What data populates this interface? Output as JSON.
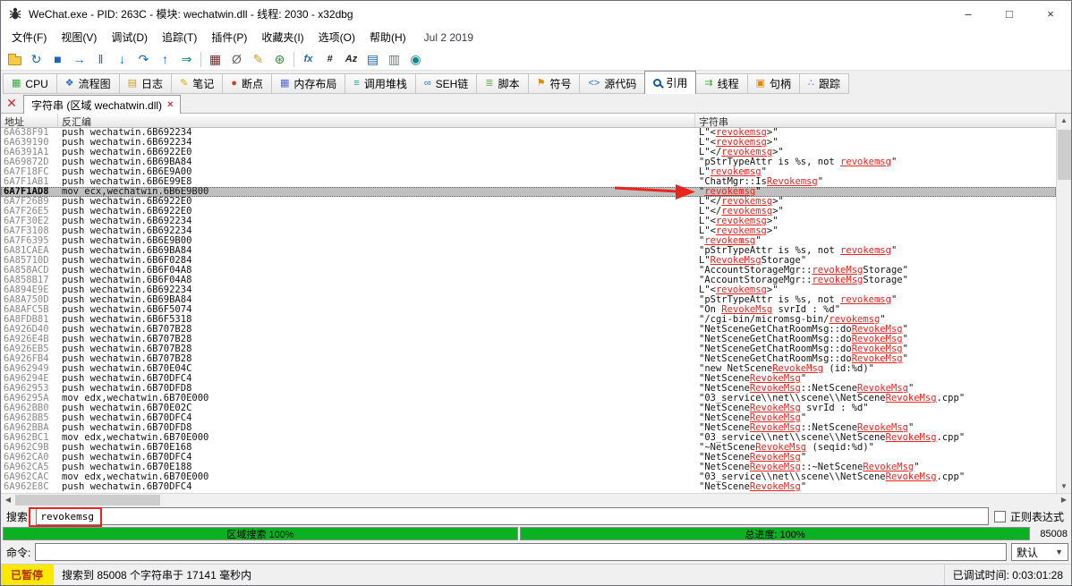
{
  "colors": {
    "progress_green": "#0ab123",
    "status_paused_bg": "#ffe800",
    "status_paused_fg": "#b32d00",
    "match_red": "#e8251f",
    "annotation_red": "#e8251f",
    "selection_gray": "#c0c0c0"
  },
  "title_bar": {
    "title": "WeChat.exe - PID: 263C - 模块: wechatwin.dll - 线程: 2030 - x32dbg",
    "minimize": "–",
    "maximize": "□",
    "close": "×"
  },
  "menu": {
    "items": [
      "文件(F)",
      "视图(V)",
      "调试(D)",
      "追踪(T)",
      "插件(P)",
      "收藏夹(I)",
      "选项(O)",
      "帮助(H)"
    ],
    "build_date": "Jul 2 2019"
  },
  "toolbar": {
    "items": [
      {
        "name": "open-file-icon",
        "type": "folder"
      },
      {
        "name": "restart-icon",
        "glyph": "↻",
        "color": "#1667c0"
      },
      {
        "name": "stop-icon",
        "glyph": "■",
        "color": "#1667c0"
      },
      {
        "name": "run-icon",
        "glyph": "→",
        "color": "#1667c0"
      },
      {
        "name": "pause-icon",
        "glyph": "‖",
        "color": "#1667c0"
      },
      {
        "name": "step-into-icon",
        "glyph": "↓",
        "color": "#1667c0"
      },
      {
        "name": "step-over-icon",
        "glyph": "↷",
        "color": "#1667c0"
      },
      {
        "name": "execute-till-return-icon",
        "glyph": "↑",
        "color": "#1667c0"
      },
      {
        "name": "run-to-user-code-icon",
        "glyph": "⇒",
        "color": "#0b8793"
      },
      {
        "name": "separator"
      },
      {
        "name": "patches-icon",
        "glyph": "▦",
        "color": "#8b1a1a"
      },
      {
        "name": "hide-debugger-icon",
        "glyph": "Ø",
        "color": "#666666"
      },
      {
        "name": "comment-icon",
        "glyph": "✎",
        "color": "#c9a227"
      },
      {
        "name": "settings-icon",
        "glyph": "⊛",
        "color": "#3a7d3a"
      },
      {
        "name": "separator"
      },
      {
        "name": "functions-icon",
        "glyph": "fx",
        "color": "#1667c0",
        "text": true
      },
      {
        "name": "calculator-icon",
        "glyph": "#",
        "color": "#222222",
        "text": true
      },
      {
        "name": "font-icon",
        "glyph": "Az",
        "color": "#222222",
        "text": true
      },
      {
        "name": "log-window-icon",
        "glyph": "▤",
        "color": "#1667c0"
      },
      {
        "name": "memory-window-icon",
        "glyph": "▥",
        "color": "#607d8b"
      },
      {
        "name": "animate-icon",
        "glyph": "◉",
        "color": "#0b8793"
      }
    ]
  },
  "tabs": [
    {
      "name": "tab-cpu",
      "label": "CPU",
      "icon": "cpu-icon",
      "glyph": "▦",
      "color": "#3da53d",
      "active": false
    },
    {
      "name": "tab-graph",
      "label": "流程图",
      "icon": "graph-icon",
      "glyph": "❖",
      "color": "#2b6fd4",
      "active": false
    },
    {
      "name": "tab-log",
      "label": "日志",
      "icon": "log-icon",
      "glyph": "▤",
      "color": "#c9a227",
      "active": false
    },
    {
      "name": "tab-notes",
      "label": "笔记",
      "icon": "notes-icon",
      "glyph": "✎",
      "color": "#d6a800",
      "active": false
    },
    {
      "name": "tab-breakpoints",
      "label": "断点",
      "icon": "breakpoint-icon",
      "glyph": "●",
      "color": "#d23f31",
      "active": false
    },
    {
      "name": "tab-memory-map",
      "label": "内存布局",
      "icon": "memory-map-icon",
      "glyph": "▦",
      "color": "#5566c9",
      "active": false
    },
    {
      "name": "tab-call-stack",
      "label": "调用堆栈",
      "icon": "call-stack-icon",
      "glyph": "≡",
      "color": "#2a9d8f",
      "active": false
    },
    {
      "name": "tab-seh",
      "label": "SEH链",
      "icon": "seh-chain-icon",
      "glyph": "∞",
      "color": "#2b6fd4",
      "active": false
    },
    {
      "name": "tab-script",
      "label": "脚本",
      "icon": "script-icon",
      "glyph": "≣",
      "color": "#6aa84f",
      "active": false
    },
    {
      "name": "tab-symbols",
      "label": "符号",
      "icon": "symbols-icon",
      "glyph": "⚑",
      "color": "#e08a00",
      "active": false
    },
    {
      "name": "tab-source",
      "label": "源代码",
      "icon": "source-icon",
      "glyph": "<>",
      "color": "#2b6fd4",
      "active": false
    },
    {
      "name": "tab-references",
      "label": "引用",
      "icon": "search-icon",
      "glyph": "",
      "color": "#13599e",
      "active": true
    },
    {
      "name": "tab-threads",
      "label": "线程",
      "icon": "threads-icon",
      "glyph": "⇉",
      "color": "#3da53d",
      "active": false
    },
    {
      "name": "tab-handles",
      "label": "句柄",
      "icon": "handles-icon",
      "glyph": "▣",
      "color": "#e08a00",
      "active": false
    },
    {
      "name": "tab-trace",
      "label": "跟踪",
      "icon": "trace-icon",
      "glyph": "∴",
      "color": "#7b4fd4",
      "active": false
    }
  ],
  "view_tab": {
    "label": "字符串 (区域 wechatwin.dll)",
    "close_glyph": "×"
  },
  "table": {
    "columns": [
      "地址",
      "反汇编",
      "字符串"
    ],
    "rows": [
      {
        "address": "6A638F91",
        "disasm": "push wechatwin.6B692234",
        "string": "L\"<revokemsg>\""
      },
      {
        "address": "6A639190",
        "disasm": "push wechatwin.6B692234",
        "string": "L\"<revokemsg>\""
      },
      {
        "address": "6A6391A1",
        "disasm": "push wechatwin.6B6922E0",
        "string": "L\"</revokemsg>\""
      },
      {
        "address": "6A69872D",
        "disasm": "push wechatwin.6B69BA84",
        "string": "\"pStrTypeAttr is %s, not revokemsg\""
      },
      {
        "address": "6A7F18FC",
        "disasm": "push wechatwin.6B6E9A00",
        "string": "L\"revokemsg\""
      },
      {
        "address": "6A7F1AB1",
        "disasm": "push wechatwin.6B6E99E8",
        "string": "\"ChatMgr::IsRevokemsg\""
      },
      {
        "address": "6A7F1AD8",
        "disasm": "mov ecx,wechatwin.6B6E9B00",
        "string": "\"revokemsg\"",
        "selected": true
      },
      {
        "address": "6A7F26B9",
        "disasm": "push wechatwin.6B6922E0",
        "string": "L\"</revokemsg>\""
      },
      {
        "address": "6A7F26E5",
        "disasm": "push wechatwin.6B6922E0",
        "string": "L\"</revokemsg>\""
      },
      {
        "address": "6A7F30E2",
        "disasm": "push wechatwin.6B692234",
        "string": "L\"<revokemsg>\""
      },
      {
        "address": "6A7F3108",
        "disasm": "push wechatwin.6B692234",
        "string": "L\"<revokemsg>\""
      },
      {
        "address": "6A7F6395",
        "disasm": "push wechatwin.6B6E9B00",
        "string": "\"revokemsg\""
      },
      {
        "address": "6A81CAEA",
        "disasm": "push wechatwin.6B69BA84",
        "string": "\"pStrTypeAttr is %s, not revokemsg\""
      },
      {
        "address": "6A85710D",
        "disasm": "push wechatwin.6B6F0284",
        "string": "L\"RevokeMsgStorage\""
      },
      {
        "address": "6A858ACD",
        "disasm": "push wechatwin.6B6F04A8",
        "string": "\"AccountStorageMgr::revokeMsgStorage\""
      },
      {
        "address": "6A858B17",
        "disasm": "push wechatwin.6B6F04A8",
        "string": "\"AccountStorageMgr::revokeMsgStorage\""
      },
      {
        "address": "6A894E9E",
        "disasm": "push wechatwin.6B692234",
        "string": "L\"<revokemsg>\""
      },
      {
        "address": "6A8A750D",
        "disasm": "push wechatwin.6B69BA84",
        "string": "\"pStrTypeAttr is %s, not revokemsg\""
      },
      {
        "address": "6A8AFC5B",
        "disasm": "push wechatwin.6B6F5074",
        "string": "\"On RevokeMsg svrId : %d\""
      },
      {
        "address": "6A8FDB81",
        "disasm": "push wechatwin.6B6F5318",
        "string": "\"/cgi-bin/micromsg-bin/revokemsg\""
      },
      {
        "address": "6A926D40",
        "disasm": "push wechatwin.6B707B28",
        "string": "\"NetSceneGetChatRoomMsg::doRevokeMsg\""
      },
      {
        "address": "6A926E4B",
        "disasm": "push wechatwin.6B707B28",
        "string": "\"NetSceneGetChatRoomMsg::doRevokeMsg\""
      },
      {
        "address": "6A926EB5",
        "disasm": "push wechatwin.6B707B28",
        "string": "\"NetSceneGetChatRoomMsg::doRevokeMsg\""
      },
      {
        "address": "6A926FB4",
        "disasm": "push wechatwin.6B707B28",
        "string": "\"NetSceneGetChatRoomMsg::doRevokeMsg\""
      },
      {
        "address": "6A962949",
        "disasm": "push wechatwin.6B70E04C",
        "string": "\"new NetSceneRevokeMsg (id:%d)\""
      },
      {
        "address": "6A96294E",
        "disasm": "push wechatwin.6B70DFC4",
        "string": "\"NetSceneRevokeMsg\""
      },
      {
        "address": "6A962953",
        "disasm": "push wechatwin.6B70DFD8",
        "string": "\"NetSceneRevokeMsg::NetSceneRevokeMsg\""
      },
      {
        "address": "6A96295A",
        "disasm": "mov edx,wechatwin.6B70E000",
        "string": "\"03_service\\\\net\\\\scene\\\\NetSceneRevokeMsg.cpp\""
      },
      {
        "address": "6A962BB0",
        "disasm": "push wechatwin.6B70E02C",
        "string": "\"NetSceneRevokeMsg svrId : %d\""
      },
      {
        "address": "6A962BB5",
        "disasm": "push wechatwin.6B70DFC4",
        "string": "\"NetSceneRevokeMsg\""
      },
      {
        "address": "6A962BBA",
        "disasm": "push wechatwin.6B70DFD8",
        "string": "\"NetSceneRevokeMsg::NetSceneRevokeMsg\""
      },
      {
        "address": "6A962BC1",
        "disasm": "mov edx,wechatwin.6B70E000",
        "string": "\"03_service\\\\net\\\\scene\\\\NetSceneRevokeMsg.cpp\""
      },
      {
        "address": "6A962C9B",
        "disasm": "push wechatwin.6B70E168",
        "string": "\"~NetSceneRevokeMsg (seqid:%d)\""
      },
      {
        "address": "6A962CA0",
        "disasm": "push wechatwin.6B70DFC4",
        "string": "\"NetSceneRevokeMsg\""
      },
      {
        "address": "6A962CA5",
        "disasm": "push wechatwin.6B70E188",
        "string": "\"NetSceneRevokeMsg::~NetSceneRevokeMsg\""
      },
      {
        "address": "6A962CAC",
        "disasm": "mov edx,wechatwin.6B70E000",
        "string": "\"03_service\\\\net\\\\scene\\\\NetSceneRevokeMsg.cpp\""
      },
      {
        "address": "6A962E8C",
        "disasm": "push wechatwin.6B70DFC4",
        "string": "\"NetSceneRevokeMsg\""
      }
    ]
  },
  "search": {
    "label": "搜索:",
    "value": "revokemsg",
    "regex_label": "正则表达式",
    "regex_checked": false
  },
  "progress": {
    "region_label": "区域搜索 100%",
    "total_label": "总进度: 100%",
    "count": "85008"
  },
  "command": {
    "label": "命令:",
    "value": "",
    "profile": "默认"
  },
  "status_bar": {
    "state": "已暂停",
    "message": "搜索到 85008 个字符串于 17141 毫秒内",
    "debug_time": "已调试时间: 0:03:01:28"
  }
}
